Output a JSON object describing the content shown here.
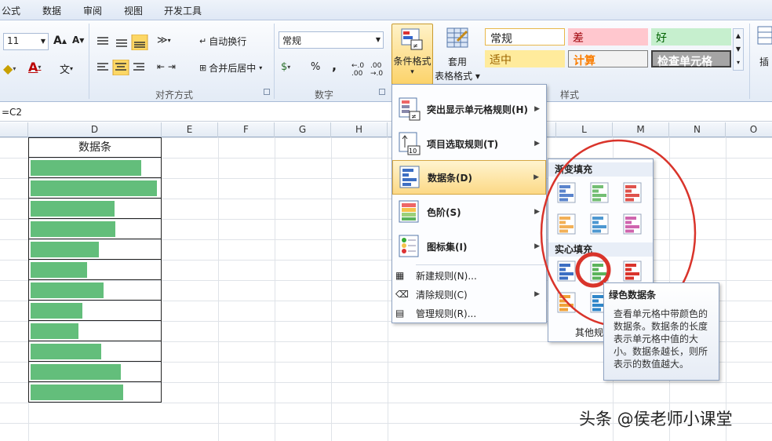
{
  "tabs": [
    "公式",
    "数据",
    "审阅",
    "视图",
    "开发工具"
  ],
  "font": {
    "size": "11"
  },
  "alignment": {
    "wrap_label": "自动换行",
    "merge_label": "合并后居中",
    "group_label": "对齐方式"
  },
  "number": {
    "format_value": "常规",
    "percent": "%",
    "comma": ",",
    "group_label": "数字"
  },
  "cf_button": {
    "line1": "条件格式",
    "line2": "▾"
  },
  "table_button": {
    "line1": "套用",
    "line2": "表格格式 ▾"
  },
  "styles": {
    "group_label": "样式",
    "items": [
      {
        "label": "常规"
      },
      {
        "label": "差"
      },
      {
        "label": "好"
      },
      {
        "label": "适中"
      },
      {
        "label": "计算"
      },
      {
        "label": "检查单元格"
      }
    ]
  },
  "insert_label": "插",
  "formula": {
    "text": "=C2"
  },
  "columns": [
    "D",
    "E",
    "F",
    "G",
    "H",
    "L",
    "M",
    "N",
    "O"
  ],
  "sheet": {
    "header": "数据条",
    "bars": [
      0.86,
      0.98,
      0.65,
      0.66,
      0.53,
      0.44,
      0.57,
      0.4,
      0.37,
      0.55,
      0.7,
      0.72
    ]
  },
  "cf_menu": {
    "items": [
      {
        "label": "突出显示单元格规则(H)"
      },
      {
        "label": "项目选取规则(T)"
      },
      {
        "label": "数据条(D)"
      },
      {
        "label": "色阶(S)"
      },
      {
        "label": "图标集(I)"
      },
      {
        "label": "新建规则(N)..."
      },
      {
        "label": "清除规则(C)"
      },
      {
        "label": "管理规则(R)..."
      }
    ]
  },
  "databar_menu": {
    "gradient_label": "渐变填充",
    "solid_label": "实心填充",
    "more_label": "其他规"
  },
  "tooltip": {
    "title": "绿色数据条",
    "lines": [
      "查看单元格中带颜色的",
      "数据条。数据条的长度",
      "表示单元格中值的大",
      "小。数据条越长，则所",
      "表示的数值越大。"
    ]
  },
  "watermark": "头条 @侯老师小课堂",
  "colors": {
    "bar": "#63be7b",
    "highlight_circle": "#d9342b",
    "selected_menu": "#fde39a"
  }
}
